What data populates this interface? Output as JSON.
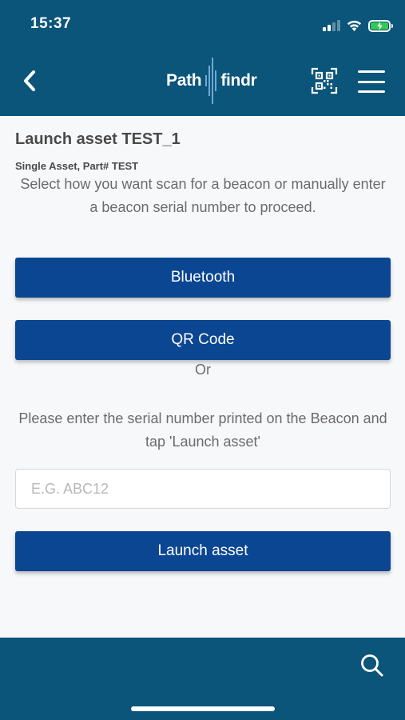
{
  "status_bar": {
    "time": "15:37",
    "icons": [
      "signal-icon",
      "wifi-icon",
      "battery-charging-icon"
    ]
  },
  "header": {
    "logo_left": "Path",
    "logo_right": "findr",
    "icons": [
      "back-chevron-icon",
      "qr-code-icon",
      "hamburger-menu-icon"
    ]
  },
  "page": {
    "title": "Launch asset TEST_1",
    "subtitle": "Single Asset, Part# TEST",
    "instructions": "Select how you want scan for a beacon or manually enter a beacon serial number to proceed."
  },
  "actions": {
    "bluetooth_label": "Bluetooth",
    "qr_label": "QR Code",
    "or_label": "Or"
  },
  "serial": {
    "instructions": "Please enter the serial number printed on the Beacon and tap 'Launch asset'",
    "placeholder": "E.G. ABC12",
    "value": "",
    "launch_label": "Launch asset"
  },
  "footer": {
    "icons": [
      "search-icon"
    ]
  },
  "colors": {
    "header_bg": "#0a5579",
    "button_bg": "#0b4692",
    "page_bg": "#f7f8fa",
    "text_dark": "#4a4a4a",
    "text_muted": "#6b6b6b",
    "battery_fill": "#35c759"
  }
}
